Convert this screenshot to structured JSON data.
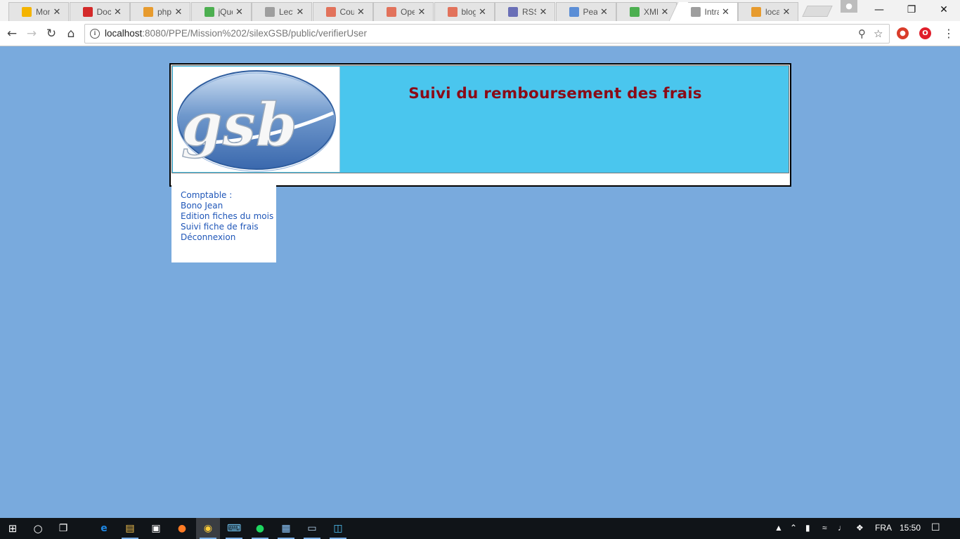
{
  "browser": {
    "tabs": [
      {
        "title": "Mon",
        "favicon": "drive-icon",
        "color": "#f4b400"
      },
      {
        "title": "Docu",
        "favicon": "free-icon",
        "color": "#d42a2a"
      },
      {
        "title": "phpM",
        "favicon": "pma-icon",
        "color": "#e79b2e"
      },
      {
        "title": "jQue",
        "favicon": "w3-icon",
        "color": "#4caf50"
      },
      {
        "title": "Lecte",
        "favicon": "page-icon",
        "color": "#9e9e9e"
      },
      {
        "title": "Cour",
        "favicon": "openclassrooms-icon",
        "color": "#e2725b"
      },
      {
        "title": "Oper",
        "favicon": "openclassrooms-icon",
        "color": "#e2725b"
      },
      {
        "title": "blog",
        "favicon": "openclassrooms-icon",
        "color": "#e2725b"
      },
      {
        "title": "RSS f",
        "favicon": "globe-icon",
        "color": "#6a6fb7"
      },
      {
        "title": "Pearl",
        "favicon": "star-icon",
        "color": "#5b8ed6"
      },
      {
        "title": "XML",
        "favicon": "w3-icon",
        "color": "#4caf50"
      },
      {
        "title": "Intra",
        "favicon": "page-icon",
        "color": "#9e9e9e",
        "active": true
      },
      {
        "title": "local",
        "favicon": "pma-icon",
        "color": "#e79b2e"
      }
    ],
    "url_host": "localhost",
    "url_rest": ":8080/PPE/Mission%202/silexGSB/public/verifierUser"
  },
  "page": {
    "title": "Suivi du remboursement des frais",
    "logo_text": "gsb",
    "menu": {
      "role": "Comptable :",
      "user": "Bono Jean",
      "items": [
        "Edition fiches du mois",
        "Suivi fiche de frais",
        "Déconnexion"
      ]
    }
  },
  "taskbar": {
    "language": "FRA",
    "time": "15:50"
  }
}
